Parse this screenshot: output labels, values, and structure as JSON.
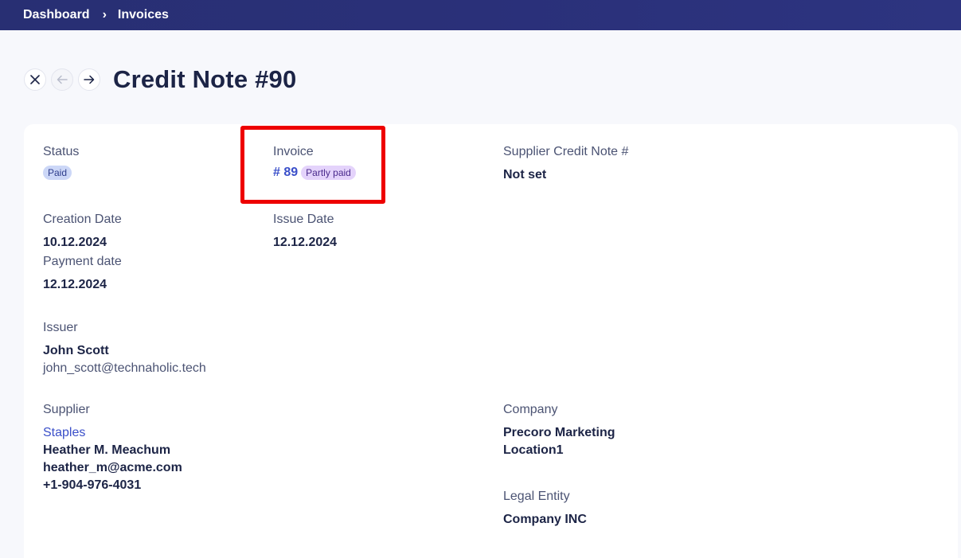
{
  "breadcrumb": {
    "items": [
      "Dashboard",
      "Invoices"
    ],
    "separator": "›"
  },
  "header": {
    "title": "Credit Note #90"
  },
  "fields": {
    "status": {
      "label": "Status",
      "badge": "Paid"
    },
    "invoice": {
      "label": "Invoice",
      "number": "# 89",
      "badge": "Partly paid"
    },
    "supplier_credit_note": {
      "label": "Supplier Credit Note #",
      "value": "Not set"
    },
    "creation_date": {
      "label": "Creation Date",
      "value": "10.12.2024"
    },
    "issue_date": {
      "label": "Issue Date",
      "value": "12.12.2024"
    },
    "payment_date": {
      "label": "Payment date",
      "value": "12.12.2024"
    },
    "issuer": {
      "label": "Issuer",
      "name": "John Scott",
      "email": "john_scott@technaholic.tech"
    },
    "supplier": {
      "label": "Supplier",
      "name": "Staples",
      "contact": "Heather M. Meachum",
      "email": "heather_m@acme.com",
      "phone": "+1-904-976-4031"
    },
    "company": {
      "label": "Company",
      "line1": "Precoro Marketing",
      "line2": "Location1"
    },
    "legal_entity": {
      "label": "Legal Entity",
      "value": "Company INC"
    }
  },
  "icons": {
    "close": "close-icon",
    "prev": "arrow-left-icon",
    "next": "arrow-right-icon"
  },
  "colors": {
    "topbar": "#2a3079",
    "highlight": "#ee0000",
    "link": "#3a4fc9",
    "badge_paid": "#ccd7f7",
    "badge_partly": "#e4d3fb"
  }
}
